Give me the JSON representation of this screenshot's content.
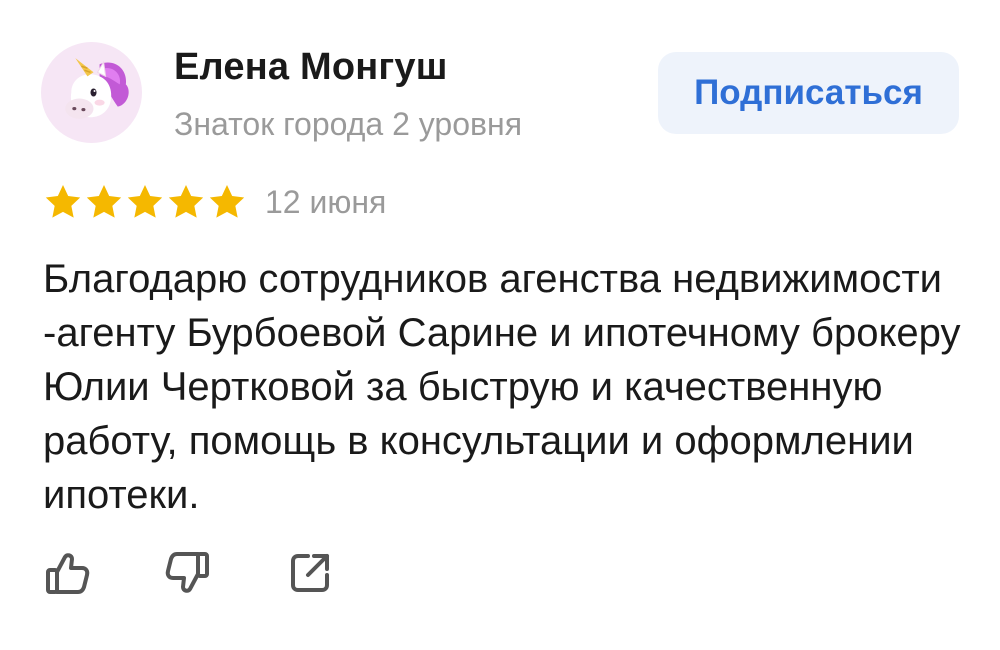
{
  "review": {
    "author": {
      "name": "Елена Монгуш",
      "level": "Знаток города 2 уровня",
      "avatar_icon": "unicorn-icon"
    },
    "subscribe_label": "Подписаться",
    "rating": {
      "value": 5,
      "max": 5,
      "color": "#f5b800"
    },
    "date": "12 июня",
    "text": "Благодарю сотрудников агенства недвижимости -агенту Бурбоевой Сарине и ипотечному брокеру Юлии Чертковой за быструю и качественную работу, помощь в консультации и оформлении ипотеки.",
    "actions": {
      "like_icon": "thumbs-up-icon",
      "dislike_icon": "thumbs-down-icon",
      "share_icon": "share-icon"
    }
  },
  "colors": {
    "accent": "#2f6fd6",
    "button_bg": "#eef3fb",
    "muted_text": "#9a9a9a",
    "text": "#1a1a1a",
    "icon": "#555555"
  }
}
